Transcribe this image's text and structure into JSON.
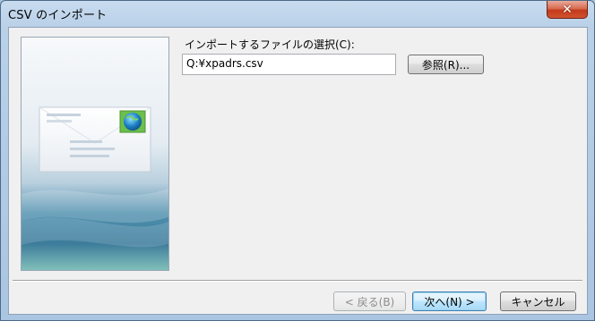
{
  "window": {
    "title": "CSV のインポート",
    "close_label": "✕"
  },
  "form": {
    "prompt": "インポートするファイルの選択(C):",
    "file_path": "Q:¥xpadrs.csv",
    "browse_label": "参照(R)..."
  },
  "footer": {
    "back_label": "< 戻る(B)",
    "next_label": "次へ(N) >",
    "cancel_label": "キャンセル"
  },
  "icons": {
    "side_image": "envelope-globe-illustration",
    "close": "close-icon"
  },
  "colors": {
    "title_bar": "#b9d0e8",
    "close_button": "#c23a1a",
    "dialog_bg": "#f0f0f0",
    "default_button": "#bee6fd"
  }
}
